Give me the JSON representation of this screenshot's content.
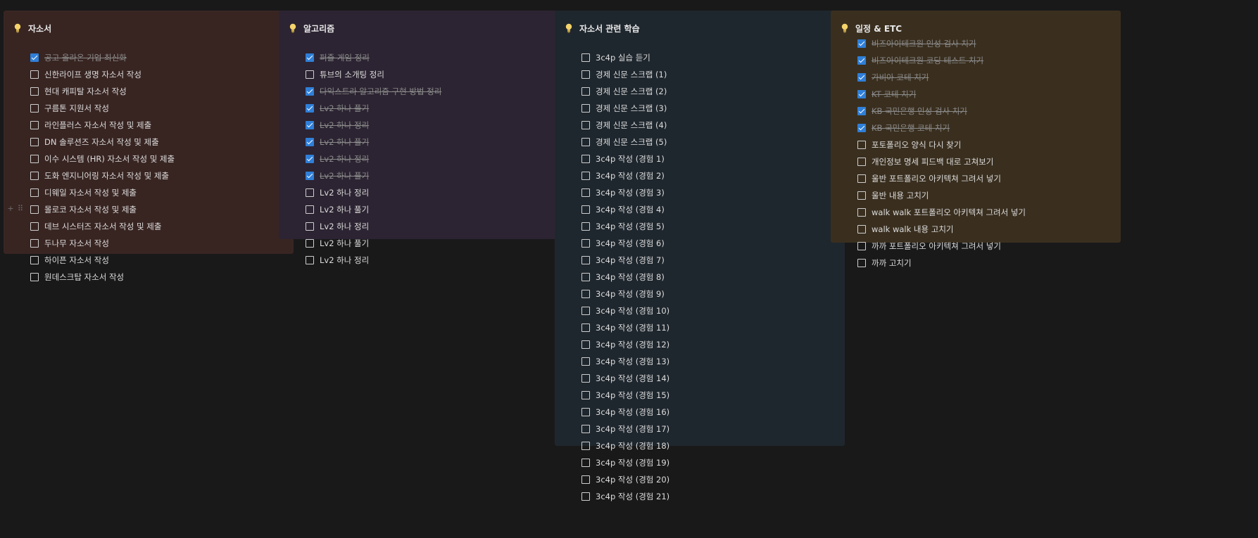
{
  "columns": [
    {
      "title": "자소서",
      "bg": "#382522",
      "items": [
        {
          "label": "공고 올라온 기업 최신화",
          "checked": true
        },
        {
          "label": "신한라이프 생명 자소서 작성",
          "checked": false
        },
        {
          "label": "현대 캐피탈 자소서 작성",
          "checked": false
        },
        {
          "label": "구름톤 지원서 작성",
          "checked": false
        },
        {
          "label": "라인플러스 자소서 작성 및 제출",
          "checked": false
        },
        {
          "label": "DN 솔루션즈 자소서 작성 및 제출",
          "checked": false
        },
        {
          "label": "이수 시스템 (HR) 자소서 작성 및 제출",
          "checked": false
        },
        {
          "label": "도화 엔지니어링 자소서 작성 및 제출",
          "checked": false
        },
        {
          "label": "디웨일 자소서 작성 및 제출",
          "checked": false
        },
        {
          "label": "몰로코 자소서 작성 및 제출",
          "checked": false
        },
        {
          "label": "데브 시스터즈 자소서 작성 및 제출",
          "checked": false
        },
        {
          "label": "두나무 자소서 작성",
          "checked": false
        },
        {
          "label": "하이픈 자소서 작성",
          "checked": false
        },
        {
          "label": "원데스크탑 자소서 작성",
          "checked": false
        }
      ]
    },
    {
      "title": "알고리즘",
      "bg": "#2c2432",
      "items": [
        {
          "label": "퍼즐 게임 정리",
          "checked": true
        },
        {
          "label": "튜브의 소개팅 정리",
          "checked": false
        },
        {
          "label": "다익스트라 알고리즘 구현 방법 정리",
          "checked": true
        },
        {
          "label": "Lv2 하나 풀기",
          "checked": true
        },
        {
          "label": "Lv2 하나 정리",
          "checked": true
        },
        {
          "label": "Lv2 하나 풀기",
          "checked": true
        },
        {
          "label": "Lv2 하나 정리",
          "checked": true
        },
        {
          "label": "Lv2 하나 풀기",
          "checked": true
        },
        {
          "label": "Lv2 하나 정리",
          "checked": false
        },
        {
          "label": "Lv2 하나 풀기",
          "checked": false
        },
        {
          "label": "Lv2 하나 정리",
          "checked": false
        },
        {
          "label": " Lv2 하나 풀기",
          "checked": false
        },
        {
          "label": "Lv2 하나 정리",
          "checked": false
        }
      ]
    },
    {
      "title": "자소서 관련 학습",
      "bg": "#1f272e",
      "items": [
        {
          "label": "3c4p 실습 듣기",
          "checked": false
        },
        {
          "label": "경제 신문 스크랩 (1)",
          "checked": false
        },
        {
          "label": "경제 신문 스크랩 (2)",
          "checked": false
        },
        {
          "label": "경제 신문 스크랩 (3)",
          "checked": false
        },
        {
          "label": "경제 신문 스크랩 (4)",
          "checked": false
        },
        {
          "label": "경제 신문 스크랩 (5)",
          "checked": false
        },
        {
          "label": "3c4p 작성 (경험 1)",
          "checked": false
        },
        {
          "label": "3c4p 작성 (경험 2)",
          "checked": false
        },
        {
          "label": "3c4p 작성 (경험 3)",
          "checked": false
        },
        {
          "label": "3c4p 작성 (경험 4)",
          "checked": false
        },
        {
          "label": "3c4p 작성 (경험 5)",
          "checked": false
        },
        {
          "label": "3c4p 작성 (경험 6)",
          "checked": false
        },
        {
          "label": "3c4p 작성 (경험 7)",
          "checked": false
        },
        {
          "label": "3c4p 작성 (경험 8)",
          "checked": false
        },
        {
          "label": "3c4p 작성 (경험 9)",
          "checked": false
        },
        {
          "label": "3c4p 작성 (경험 10)",
          "checked": false
        },
        {
          "label": "3c4p 작성 (경험 11)",
          "checked": false
        },
        {
          "label": "3c4p 작성 (경험 12)",
          "checked": false
        },
        {
          "label": "3c4p 작성 (경험 13)",
          "checked": false
        },
        {
          "label": "3c4p 작성 (경험 14)",
          "checked": false
        },
        {
          "label": "3c4p 작성 (경험 15)",
          "checked": false
        },
        {
          "label": "3c4p 작성 (경험 16)",
          "checked": false
        },
        {
          "label": "3c4p 작성 (경험 17)",
          "checked": false
        },
        {
          "label": "3c4p 작성 (경험 18)",
          "checked": false
        },
        {
          "label": "3c4p 작성 (경험 19)",
          "checked": false
        },
        {
          "label": "3c4p 작성 (경험 20)",
          "checked": false
        },
        {
          "label": "3c4p 작성 (경험 21)",
          "checked": false
        }
      ]
    },
    {
      "title": "일정 & ETC",
      "bg": "#3a2f1f",
      "items": [
        {
          "label": "비즈아이테크원 인성 검사 치기",
          "checked": true
        },
        {
          "label": "비즈아이테크원 코딩 테스트 치기",
          "checked": true
        },
        {
          "label": "가비아 코테 치기",
          "checked": true
        },
        {
          "label": "KT 코테 치기",
          "checked": true
        },
        {
          "label": "KB 국민은행 인성 검사 치기",
          "checked": true
        },
        {
          "label": "KB 국민은행 코테 치기",
          "checked": true
        },
        {
          "label": "포토폴리오 양식 다시 찾기",
          "checked": false
        },
        {
          "label": "개인정보 명세 피드백 대로 고쳐보기",
          "checked": false
        },
        {
          "label": "울반 포트폴리오 아키텍쳐 그려서 넣기",
          "checked": false
        },
        {
          "label": "울반 내용 고치기",
          "checked": false
        },
        {
          "label": "walk walk 포트폴리오 아키텍쳐 그려서 넣기",
          "checked": false
        },
        {
          "label": "walk walk 내용 고치기",
          "checked": false
        },
        {
          "label": "까까 포트폴리오 아키텍쳐 그려서 넣기",
          "checked": false
        },
        {
          "label": "까까 고치기",
          "checked": false
        }
      ]
    }
  ],
  "icons": {
    "header": "lightbulb-icon",
    "row_add": "plus-icon",
    "row_drag": "drag-handle-icon"
  },
  "colors": {
    "page_bg": "#191919",
    "checkbox_checked": "#2f7fd8"
  }
}
